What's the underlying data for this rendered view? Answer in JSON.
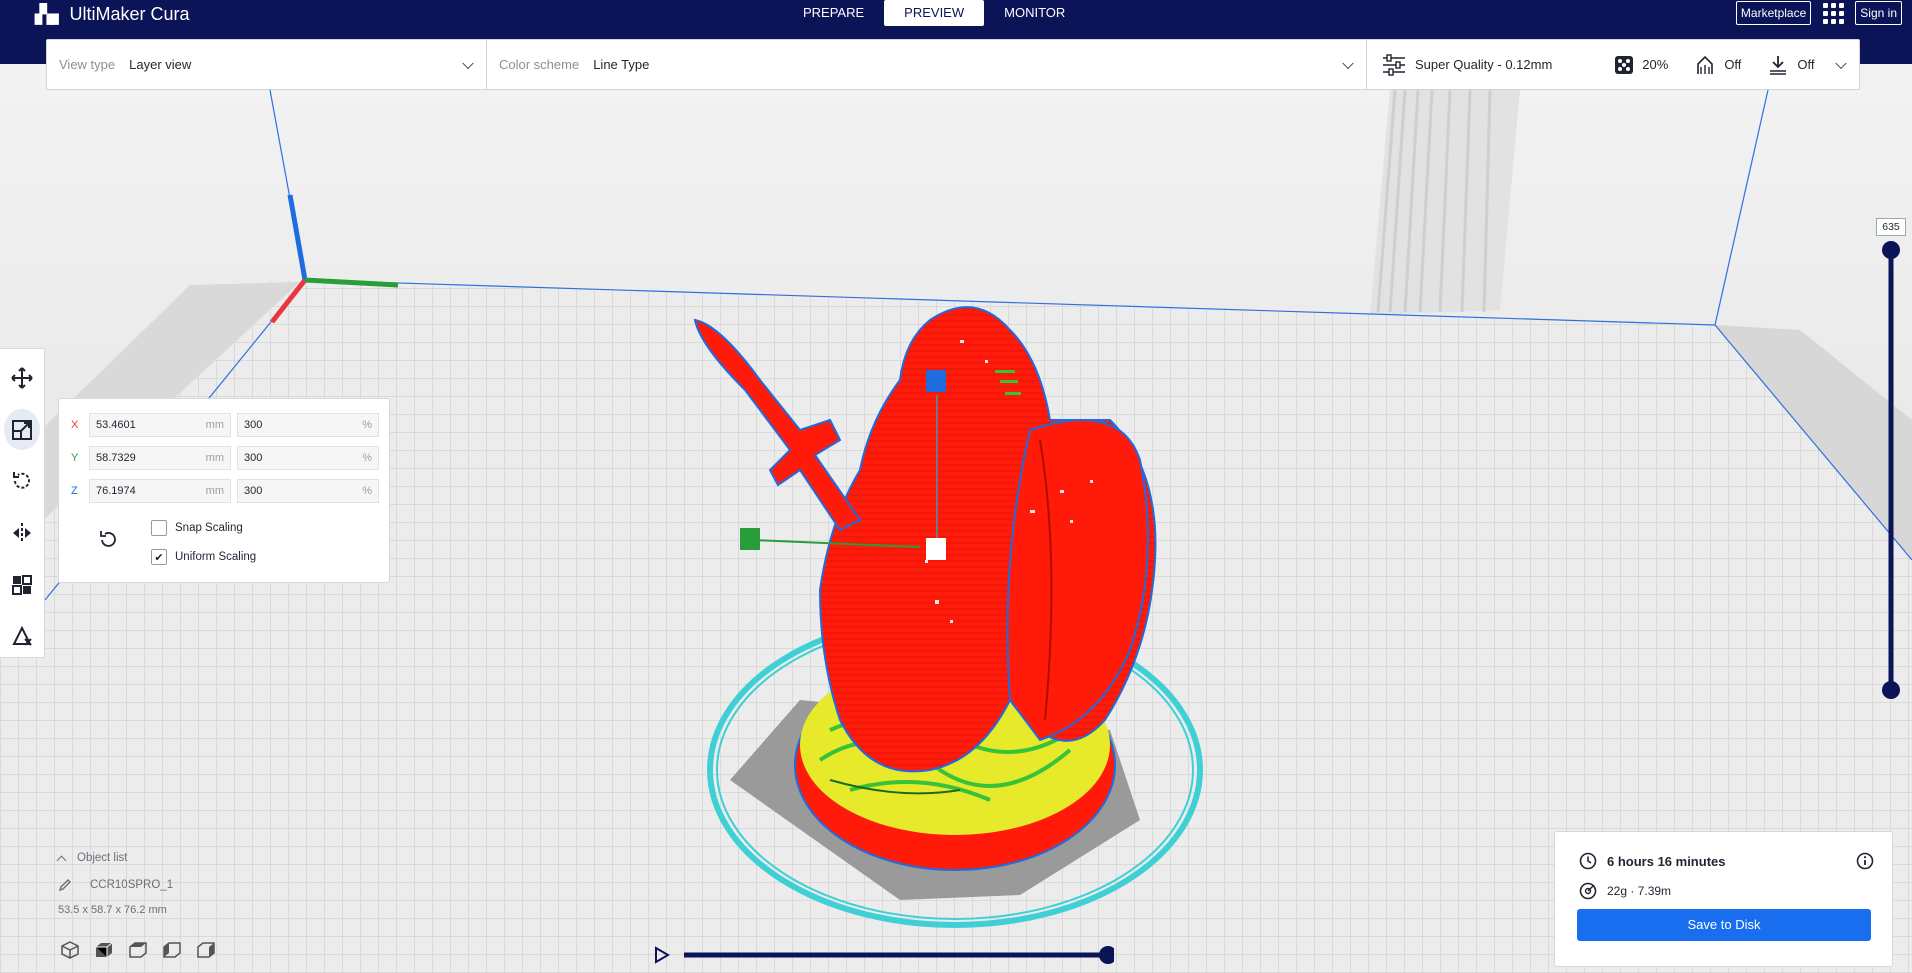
{
  "app": {
    "title": "UltiMaker Cura"
  },
  "stages": [
    "PREPARE",
    "PREVIEW",
    "MONITOR"
  ],
  "header_right": {
    "marketplace": "Marketplace",
    "sign_in": "Sign in"
  },
  "toolbar": {
    "view_type_label": "View type",
    "view_type_value": "Layer view",
    "color_scheme_label": "Color scheme",
    "color_scheme_value": "Line Type",
    "profile": "Super Quality - 0.12mm",
    "infill": "20%",
    "support": "Off",
    "adhesion": "Off"
  },
  "scale_panel": {
    "rows": [
      {
        "axis": "X",
        "value": "53.4601",
        "unit": "mm",
        "percent": "300",
        "percent_unit": "%"
      },
      {
        "axis": "Y",
        "value": "58.7329",
        "unit": "mm",
        "percent": "300",
        "percent_unit": "%"
      },
      {
        "axis": "Z",
        "value": "76.1974",
        "unit": "mm",
        "percent": "300",
        "percent_unit": "%"
      }
    ],
    "snap_scaling": "Snap Scaling",
    "uniform_scaling": "Uniform Scaling",
    "snap_checked": false,
    "uniform_checked": true
  },
  "object_list": {
    "title": "Object list",
    "item": "CCR10SPRO_1",
    "dimensions": "53.5 x 58.7 x 76.2 mm"
  },
  "layer_slider": {
    "current_layer": "635"
  },
  "print_info": {
    "time": "6 hours 16 minutes",
    "material": "22g · 7.39m",
    "save_button": "Save to Disk"
  },
  "colors": {
    "header_bg": "#0a1457",
    "accent": "#196ef0",
    "axis_x": "#e8383d",
    "axis_y": "#2a9d3b",
    "axis_z": "#1f6ce0",
    "model": "#ff1a0a",
    "infill": "#e6ea2a",
    "skirt": "#3fd0d6"
  }
}
